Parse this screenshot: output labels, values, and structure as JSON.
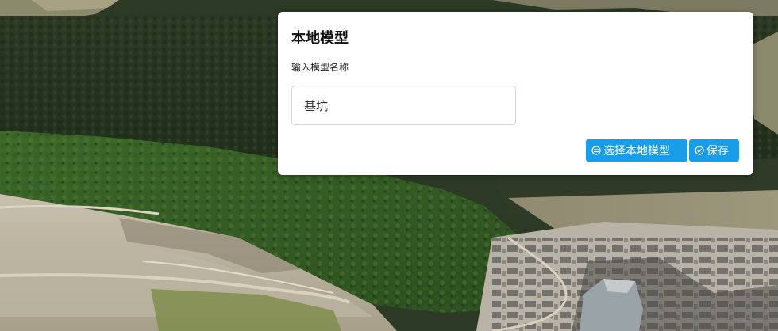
{
  "dialog": {
    "title": "本地模型",
    "field_label": "输入模型名称",
    "name_value": "基坑",
    "name_placeholder": "",
    "buttons": {
      "select_label": "选择本地模型",
      "select_icon": "upload-icon",
      "save_label": "保存",
      "save_icon": "check-circle-icon"
    }
  },
  "colors": {
    "button_bg": "#1a9de8",
    "dialog_bg": "#ffffff"
  }
}
